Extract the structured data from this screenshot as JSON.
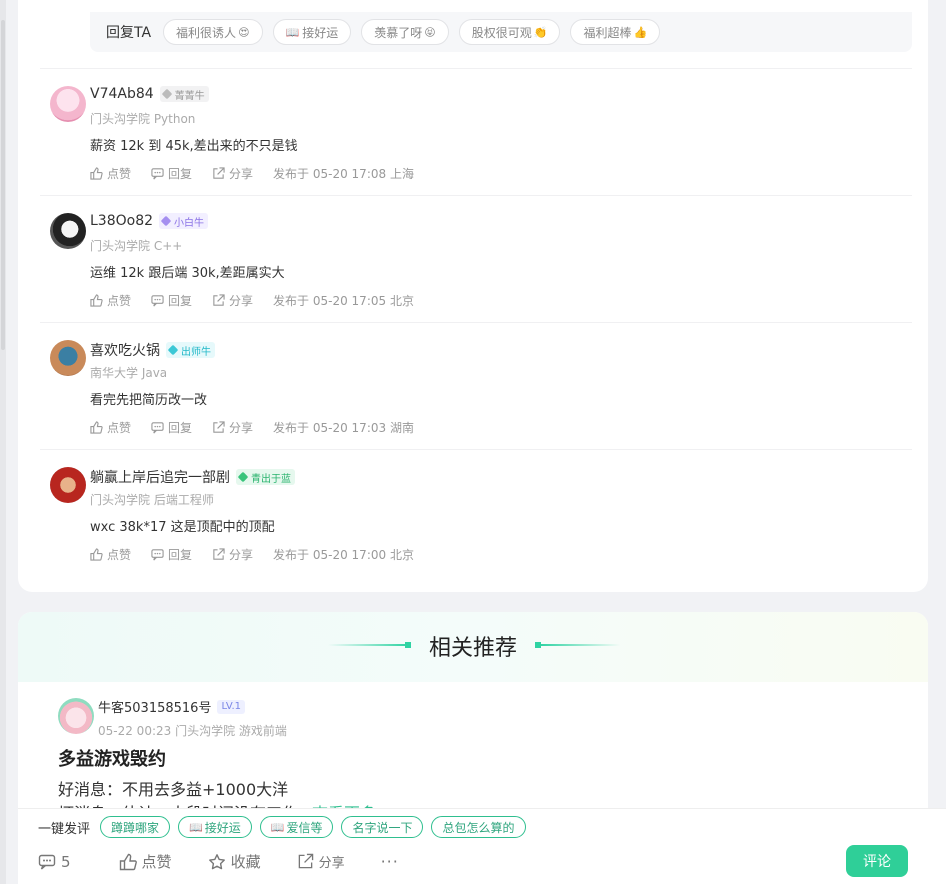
{
  "reply_bar": {
    "label": "回复TA",
    "chips": [
      {
        "text": "福利很诱人",
        "emoji": "😍"
      },
      {
        "text": "接好运",
        "prefix": "📖"
      },
      {
        "text": "羡慕了呀",
        "emoji": "😝"
      },
      {
        "text": "股权很可观",
        "emoji": "👏"
      },
      {
        "text": "福利超棒",
        "emoji": "👍"
      }
    ]
  },
  "comments": [
    {
      "user": "V74Ab84",
      "level": "菁菁牛",
      "level_color": "gray",
      "school": "门头沟学院 Python",
      "text": "薪资 12k 到 45k,差出来的不只是钱",
      "like": "点赞",
      "reply": "回复",
      "share": "分享",
      "posted": "发布于 05-20 17:08 上海"
    },
    {
      "user": "L38Oo82",
      "level": "小白牛",
      "level_color": "purple",
      "school": "门头沟学院 C++",
      "text": "运维 12k 跟后端 30k,差距属实大",
      "like": "点赞",
      "reply": "回复",
      "share": "分享",
      "posted": "发布于 05-20 17:05 北京"
    },
    {
      "user": "喜欢吃火锅",
      "level": "出师牛",
      "level_color": "cyan",
      "school": "南华大学 Java",
      "text": "看完先把简历改一改",
      "like": "点赞",
      "reply": "回复",
      "share": "分享",
      "posted": "发布于 05-20 17:03 湖南"
    },
    {
      "user": "躺赢上岸后追完一部剧",
      "level": "青出于蓝",
      "level_color": "green",
      "school": "门头沟学院 后端工程师",
      "text": "wxc 38k*17 这是顶配中的顶配",
      "like": "点赞",
      "reply": "回复",
      "share": "分享",
      "posted": "发布于 05-20 17:00 北京"
    }
  ],
  "recommend": {
    "title": "相关推荐",
    "post": {
      "user": "牛客503158516号",
      "level": "LV.1",
      "meta": "05-22 00:23  门头沟学院 游戏前端",
      "title": "多益游戏毁约",
      "line1": "好消息：不用去多益+1000大洋",
      "line2": "坏消息：估计一大段时间没有工作",
      "see_more": "查看更多"
    }
  },
  "bottom": {
    "quick_label": "一键发评",
    "quick_chips": [
      {
        "text": "蹲蹲哪家"
      },
      {
        "text": "接好运",
        "prefix": "📖"
      },
      {
        "text": "爱信等",
        "prefix": "📖"
      },
      {
        "text": "名字说一下"
      },
      {
        "text": "总包怎么算的"
      }
    ],
    "comment_count": "5",
    "like": "点赞",
    "favorite": "收藏",
    "share": "分享",
    "more": "···",
    "comment_button": "评论"
  },
  "colors": {
    "accent": "#2fcf98",
    "link": "#2fbf8f"
  }
}
